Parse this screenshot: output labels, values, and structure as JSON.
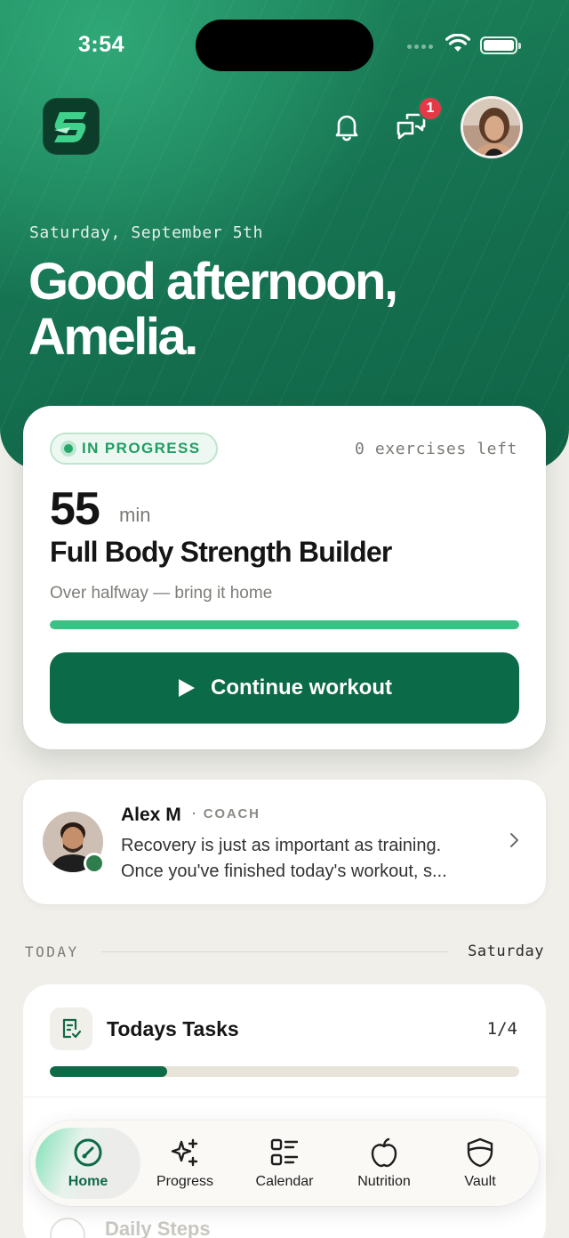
{
  "status_bar": {
    "time": "3:54"
  },
  "header": {
    "notifications_badge": "1"
  },
  "hero": {
    "date": "Saturday, September 5th",
    "greeting": "Good afternoon,\nAmelia."
  },
  "workout": {
    "status": "IN PROGRESS",
    "exercises_left": "0 exercises left",
    "duration_value": "55",
    "duration_unit": "min",
    "title": "Full Body Strength Builder",
    "subtitle": "Over halfway — bring it home",
    "progress_fraction": 1.0,
    "cta_label": "Continue workout"
  },
  "coach": {
    "name": "Alex M",
    "role": "· COACH",
    "message_line1": "Recovery is just as important as training.",
    "message_line2": "Once you've finished today's workout, s..."
  },
  "today": {
    "label": "TODAY",
    "day": "Saturday"
  },
  "tasks": {
    "title": "Todays Tasks",
    "count": "1/4",
    "progress_fraction": 0.25,
    "next_item": "Daily Steps"
  },
  "tabbar": {
    "items": [
      {
        "label": "Home",
        "icon": "gauge-icon",
        "active": true
      },
      {
        "label": "Progress",
        "icon": "sparkles-icon",
        "active": false
      },
      {
        "label": "Calendar",
        "icon": "list-grid-icon",
        "active": false
      },
      {
        "label": "Nutrition",
        "icon": "apple-icon",
        "active": false
      },
      {
        "label": "Vault",
        "icon": "shield-icon",
        "active": false
      }
    ]
  },
  "colors": {
    "brand_green": "#0b6a48",
    "hero_green": "#167352",
    "progress_green": "#3cc184",
    "badge_red": "#e53948"
  }
}
